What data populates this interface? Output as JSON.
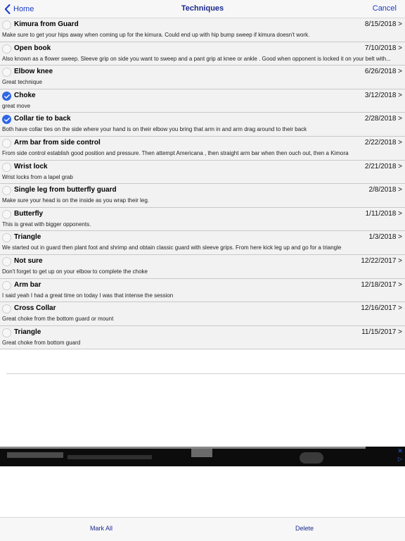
{
  "nav": {
    "back_label": "Home",
    "title": "Techniques",
    "cancel_label": "Cancel"
  },
  "rows": [
    {
      "title": "Kimura from Guard",
      "date": "8/15/2018 >",
      "note": "Make sure to get your hips away when coming up for the kimura.  Could end up with hip bump sweep if kimura doesn't work.",
      "checked": false
    },
    {
      "title": "Open book",
      "date": "7/10/2018 >",
      "note": "Also known as a flower sweep. Sleeve grip on side you want to sweep and a pant grip at knee or ankle .  Good when opponent is locked it on your belt with...",
      "checked": false
    },
    {
      "title": "Elbow knee",
      "date": "6/26/2018 >",
      "note": "Great technique",
      "checked": false
    },
    {
      "title": "Choke",
      "date": "3/12/2018 >",
      "note": "great move",
      "checked": true
    },
    {
      "title": "Collar tie to back",
      "date": "2/28/2018 >",
      "note": "Both have collar ties on the side where your hand is on their elbow you bring that arm in and arm drag around to their back",
      "checked": true
    },
    {
      "title": "Arm bar from side control",
      "date": "2/22/2018 >",
      "note": "From side control establish good position and pressure.  Then attempt Americana , then straight arm bar when then ouch out, then a Kimora",
      "checked": false
    },
    {
      "title": "Wrist lock",
      "date": "2/21/2018 >",
      "note": "Wrist locks from a lapel grab",
      "checked": false
    },
    {
      "title": "Single leg from butterfly guard",
      "date": "2/8/2018 >",
      "note": "Make sure your head is on the inside as you wrap their leg.",
      "checked": false
    },
    {
      "title": "Butterfly",
      "date": "1/11/2018 >",
      "note": "This is great with bigger opponents.",
      "checked": false
    },
    {
      "title": "Triangle",
      "date": "1/3/2018 >",
      "note": "We started out in guard then plant foot and shrimp and obtain classic guard with sleeve grips.  From here kick leg up and go for a triangle",
      "checked": false
    },
    {
      "title": "Not sure",
      "date": "12/22/2017 >",
      "note": "Don't forget to get up on your elbow to complete the choke",
      "checked": false
    },
    {
      "title": "Arm bar",
      "date": "12/18/2017 >",
      "note": "I said yeah I had a great time on today I was that intense the session",
      "checked": false
    },
    {
      "title": "Cross Collar",
      "date": "12/16/2017 >",
      "note": "Great choke from the bottom guard or mount",
      "checked": false
    },
    {
      "title": "Triangle",
      "date": "11/15/2017 >",
      "note": "Great choke from bottom guard",
      "checked": false
    }
  ],
  "ad": {
    "close_glyph": "✕",
    "info_glyph": "▷"
  },
  "toolbar": {
    "mark_all_label": "Mark All",
    "delete_label": "Delete"
  },
  "colors": {
    "accent": "#1a3cc8",
    "check_on": "#2f66e6"
  },
  "icons": {
    "back": "chevron-left-icon",
    "checked": "checkmark-circle-icon",
    "unchecked": "empty-circle-icon"
  }
}
